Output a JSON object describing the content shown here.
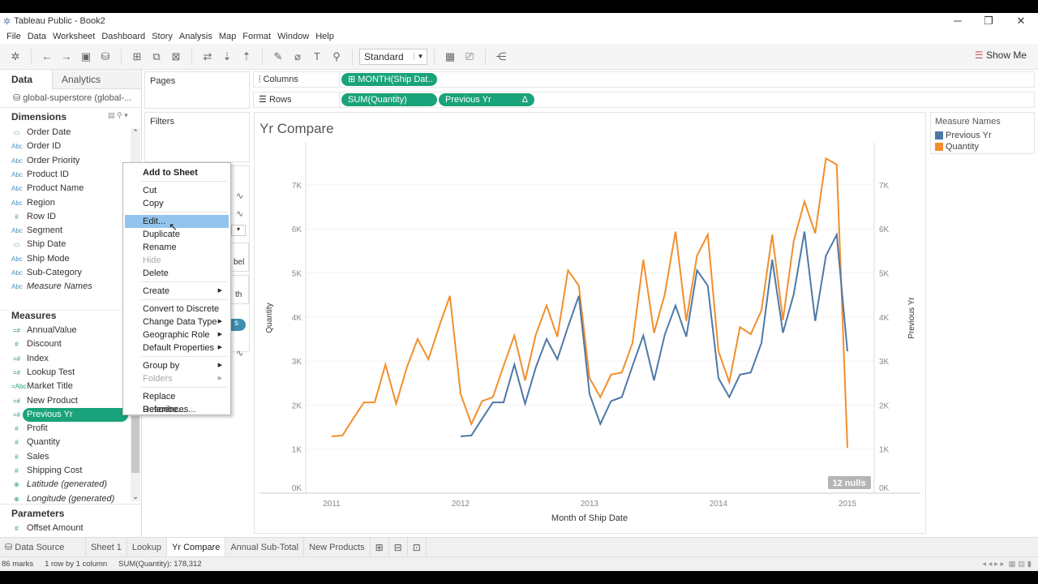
{
  "window": {
    "title": "Tableau Public - Book2",
    "minimize": "─",
    "restore": "❐",
    "close": "✕"
  },
  "menu": [
    "File",
    "Data",
    "Worksheet",
    "Dashboard",
    "Story",
    "Analysis",
    "Map",
    "Format",
    "Window",
    "Help"
  ],
  "toolbar": {
    "icons": [
      {
        "name": "tableau-logo-icon",
        "glyph": "✲"
      },
      {
        "name": "sep"
      },
      {
        "name": "undo-icon",
        "glyph": "←"
      },
      {
        "name": "redo-icon",
        "glyph": "→"
      },
      {
        "name": "save-icon",
        "glyph": "▣"
      },
      {
        "name": "new-datasource-icon",
        "glyph": "⛁"
      },
      {
        "name": "sep"
      },
      {
        "name": "new-worksheet-icon",
        "glyph": "⊞"
      },
      {
        "name": "duplicate-sheet-icon",
        "glyph": "⧉"
      },
      {
        "name": "clear-sheet-icon",
        "glyph": "⊠"
      },
      {
        "name": "sep"
      },
      {
        "name": "swap-icon",
        "glyph": "⇄"
      },
      {
        "name": "sort-ascending-icon",
        "glyph": "⇣"
      },
      {
        "name": "sort-descending-icon",
        "glyph": "⇡"
      },
      {
        "name": "sep"
      },
      {
        "name": "highlight-icon",
        "glyph": "✎"
      },
      {
        "name": "group-icon",
        "glyph": "⌀"
      },
      {
        "name": "labels-icon",
        "glyph": "T"
      },
      {
        "name": "pin-icon",
        "glyph": "⚲"
      }
    ],
    "fit": "Standard",
    "icons_after": [
      {
        "name": "show-cards-icon",
        "glyph": "▦"
      },
      {
        "name": "presentation-icon",
        "glyph": "⎚"
      },
      {
        "name": "sep"
      },
      {
        "name": "share-icon",
        "glyph": "⋲"
      }
    ],
    "show_me": "Show Me"
  },
  "left_panel": {
    "tabs": [
      "Data",
      "Analytics"
    ],
    "datasource": "global-superstore (global-...",
    "dimensions_title": "Dimensions",
    "dimensions": [
      {
        "icon": "▭",
        "label": "Order Date"
      },
      {
        "icon": "Abc",
        "label": "Order ID"
      },
      {
        "icon": "Abc",
        "label": "Order Priority"
      },
      {
        "icon": "Abc",
        "label": "Product ID"
      },
      {
        "icon": "Abc",
        "label": "Product Name"
      },
      {
        "icon": "Abc",
        "label": "Region"
      },
      {
        "icon": "#",
        "label": "Row ID"
      },
      {
        "icon": "Abc",
        "label": "Segment"
      },
      {
        "icon": "▭",
        "label": "Ship Date"
      },
      {
        "icon": "Abc",
        "label": "Ship Mode"
      },
      {
        "icon": "Abc",
        "label": "Sub-Category"
      },
      {
        "icon": "Abc",
        "label": "Measure Names",
        "italic": true
      }
    ],
    "measures_title": "Measures",
    "measures": [
      {
        "icon": "=#",
        "label": "AnnualValue"
      },
      {
        "icon": "#",
        "label": "Discount"
      },
      {
        "icon": "=#",
        "label": "Index"
      },
      {
        "icon": "=#",
        "label": "Lookup Test"
      },
      {
        "icon": "=Abc",
        "label": "Market Title"
      },
      {
        "icon": "=#",
        "label": "New Product"
      },
      {
        "icon": "=#",
        "label": "Previous Yr",
        "selected": true
      },
      {
        "icon": "#",
        "label": "Profit"
      },
      {
        "icon": "#",
        "label": "Quantity"
      },
      {
        "icon": "#",
        "label": "Sales"
      },
      {
        "icon": "#",
        "label": "Shipping Cost"
      },
      {
        "icon": "⊕",
        "label": "Latitude (generated)",
        "italic": true
      },
      {
        "icon": "⊕",
        "label": "Longitude (generated)",
        "italic": true
      }
    ],
    "parameters_title": "Parameters",
    "parameters": [
      {
        "icon": "#",
        "label": "Offset Amount"
      }
    ]
  },
  "cards": {
    "pages": "Pages",
    "filters": "Filters",
    "marks_fragments": {
      "label": "bel",
      "path": "th",
      "pill": "s"
    }
  },
  "shelves": {
    "columns": {
      "label": "Columns",
      "pills": [
        "⊞ MONTH(Ship Dat.."
      ]
    },
    "rows": {
      "label": "Rows",
      "pills": [
        "SUM(Quantity)",
        "Previous Yr"
      ],
      "delta": "Δ"
    }
  },
  "context_menu": [
    {
      "label": "Add to Sheet",
      "bold": true
    },
    {
      "sep": true
    },
    {
      "label": "Cut"
    },
    {
      "label": "Copy"
    },
    {
      "sep": true
    },
    {
      "label": "Edit...",
      "highlighted": true
    },
    {
      "label": "Duplicate"
    },
    {
      "label": "Rename"
    },
    {
      "label": "Hide",
      "disabled": true
    },
    {
      "label": "Delete"
    },
    {
      "sep": true
    },
    {
      "label": "Create",
      "submenu": true
    },
    {
      "sep": true
    },
    {
      "label": "Convert to Discrete"
    },
    {
      "label": "Change Data Type",
      "submenu": true
    },
    {
      "label": "Geographic Role",
      "submenu": true
    },
    {
      "label": "Default Properties",
      "submenu": true
    },
    {
      "sep": true
    },
    {
      "label": "Group by",
      "submenu": true
    },
    {
      "label": "Folders",
      "submenu": true,
      "disabled": true
    },
    {
      "sep": true
    },
    {
      "label": "Replace References..."
    },
    {
      "label": "Describe..."
    }
  ],
  "legend": {
    "title": "Measure Names",
    "items": [
      {
        "label": "Previous Yr",
        "color": "#4e79a7"
      },
      {
        "label": "Quantity",
        "color": "#f28e2b"
      }
    ]
  },
  "chart_data": {
    "type": "line",
    "title": "Yr Compare",
    "xlabel": "Month of Ship Date",
    "ylabel": "Quantity",
    "ylabel_right": "Previous Yr",
    "x": [
      "2011-01",
      "2011-02",
      "2011-03",
      "2011-04",
      "2011-05",
      "2011-06",
      "2011-07",
      "2011-08",
      "2011-09",
      "2011-10",
      "2011-11",
      "2011-12",
      "2012-01",
      "2012-02",
      "2012-03",
      "2012-04",
      "2012-05",
      "2012-06",
      "2012-07",
      "2012-08",
      "2012-09",
      "2012-10",
      "2012-11",
      "2012-12",
      "2013-01",
      "2013-02",
      "2013-03",
      "2013-04",
      "2013-05",
      "2013-06",
      "2013-07",
      "2013-08",
      "2013-09",
      "2013-10",
      "2013-11",
      "2013-12",
      "2014-01",
      "2014-02",
      "2014-03",
      "2014-04",
      "2014-05",
      "2014-06",
      "2014-07",
      "2014-08",
      "2014-09",
      "2014-10",
      "2014-11",
      "2014-12",
      "2015-01"
    ],
    "x_ticks": [
      "2011",
      "2012",
      "2013",
      "2014",
      "2015"
    ],
    "y_ticks": [
      "0K",
      "1K",
      "2K",
      "3K",
      "4K",
      "5K",
      "6K",
      "7K"
    ],
    "ylim": [
      0,
      7700
    ],
    "grid": true,
    "legend": "right",
    "series": [
      {
        "name": "Quantity",
        "color": "#f28e2b",
        "values": [
          1290,
          1310,
          1690,
          2060,
          2060,
          2920,
          2030,
          2860,
          3500,
          3040,
          3780,
          4480,
          2250,
          1570,
          2090,
          2180,
          2890,
          3580,
          2560,
          3600,
          4260,
          3550,
          5060,
          4710,
          2610,
          2180,
          2690,
          2740,
          3410,
          5300,
          3640,
          4520,
          5940,
          3910,
          5390,
          5870,
          3220,
          2520,
          3770,
          3610,
          4150,
          5870,
          3930,
          5730,
          6620,
          5900,
          7600,
          7460,
          1030
        ]
      },
      {
        "name": "Previous Yr",
        "color": "#4e79a7",
        "values": [
          null,
          null,
          null,
          null,
          null,
          null,
          null,
          null,
          null,
          null,
          null,
          null,
          1290,
          1310,
          1690,
          2060,
          2060,
          2920,
          2030,
          2860,
          3500,
          3040,
          3780,
          4480,
          2250,
          1570,
          2090,
          2180,
          2890,
          3580,
          2560,
          3600,
          4260,
          3550,
          5060,
          4710,
          2610,
          2180,
          2690,
          2740,
          3410,
          5300,
          3640,
          4520,
          5940,
          3910,
          5390,
          5870,
          3220
        ]
      }
    ],
    "nulls_indicator": "12 nulls"
  },
  "sheet_tabs": {
    "datasource": "⛁ Data Source",
    "tabs": [
      "Sheet 1",
      "Lookup",
      "Yr Compare",
      "Annual Sub-Total",
      "New Products"
    ],
    "active": "Yr Compare",
    "new_icons": [
      "⊞",
      "⊟",
      "⊡"
    ]
  },
  "status": {
    "marks": "86 marks",
    "dims": "1 row by 1 column",
    "sum": "SUM(Quantity): 178,312"
  }
}
